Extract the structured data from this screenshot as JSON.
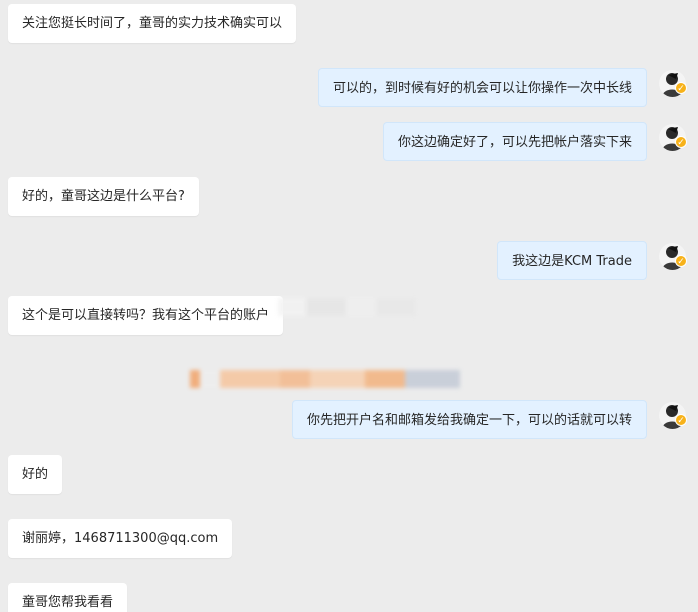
{
  "messages": [
    {
      "side": "left",
      "text": "关注您挺长时间了，童哥的实力技术确实可以"
    },
    {
      "side": "right",
      "text": "可以的，到时候有好的机会可以让你操作一次中长线"
    },
    {
      "side": "right",
      "text": "你这边确定好了，可以先把帐户落实下来"
    },
    {
      "side": "left",
      "text": "好的，童哥这边是什么平台?"
    },
    {
      "side": "right",
      "text": "我这边是KCM Trade"
    },
    {
      "side": "left",
      "text": "这个是可以直接转吗？我有这个平台的账户"
    },
    {
      "side": "right",
      "text": "你先把开户名和邮箱发给我确定一下，可以的话就可以转"
    },
    {
      "side": "left",
      "text": "好的"
    },
    {
      "side": "left",
      "text": "谢丽婷，1468711300@qq.com"
    },
    {
      "side": "left",
      "text": "童哥您帮我看看"
    }
  ],
  "icons": {
    "avatar": "user-avatar-icon",
    "verified": "verified-badge-icon"
  },
  "colors": {
    "background": "#ececec",
    "left_bubble": "#ffffff",
    "right_bubble": "#e3f1ff",
    "badge": "#f7b21a"
  }
}
